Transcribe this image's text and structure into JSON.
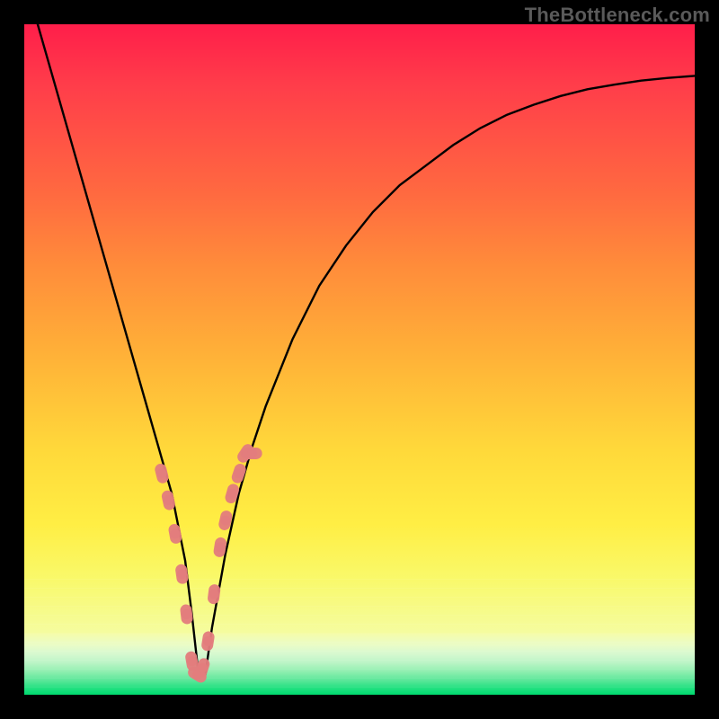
{
  "watermark": "TheBottleneck.com",
  "chart_data": {
    "type": "line",
    "title": "",
    "xlabel": "",
    "ylabel": "",
    "xlim": [
      0,
      100
    ],
    "ylim": [
      0,
      100
    ],
    "grid": false,
    "legend": false,
    "series": [
      {
        "name": "bottleneck-curve",
        "color": "#000000",
        "x": [
          2,
          4,
          6,
          8,
          10,
          12,
          14,
          16,
          18,
          20,
          22,
          24,
          25,
          26,
          27,
          28,
          30,
          32,
          34,
          36,
          38,
          40,
          44,
          48,
          52,
          56,
          60,
          64,
          68,
          72,
          76,
          80,
          84,
          88,
          92,
          96,
          100
        ],
        "values": [
          100,
          93,
          86,
          79,
          72,
          65,
          58,
          51,
          44,
          37,
          30,
          20,
          12,
          3,
          3,
          10,
          21,
          30,
          37,
          43,
          48,
          53,
          61,
          67,
          72,
          76,
          79,
          82,
          84.5,
          86.5,
          88,
          89.3,
          90.3,
          91,
          91.6,
          92,
          92.3
        ]
      }
    ],
    "marker_points": {
      "name": "salmon-markers",
      "color": "#e37d7d",
      "x": [
        20.5,
        21.5,
        22.5,
        23.5,
        24.2,
        25,
        25.8,
        26.6,
        27.4,
        28.3,
        29.2,
        30,
        31,
        32,
        33,
        34
      ],
      "values": [
        33,
        29,
        24,
        18,
        12,
        5,
        3,
        4,
        8,
        15,
        22,
        26,
        30,
        33,
        36,
        36
      ]
    },
    "minimum_x": 26
  }
}
